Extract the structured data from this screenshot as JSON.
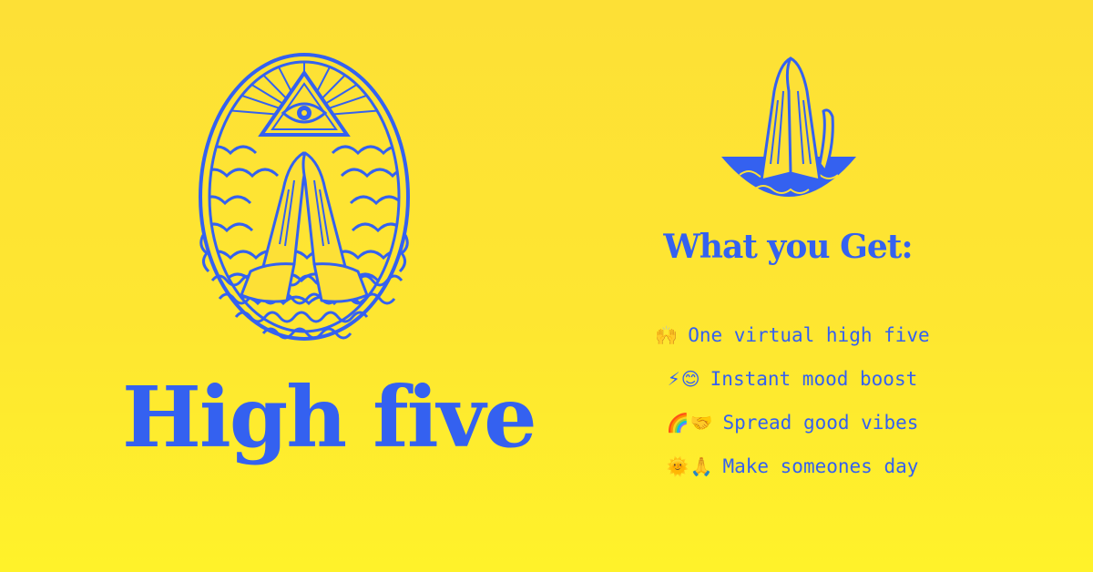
{
  "hero": {
    "title": "High five"
  },
  "sidebar": {
    "heading": "What you Get:",
    "items": [
      {
        "emoji": "🙌",
        "label": "One virtual high five"
      },
      {
        "emoji": "⚡😊",
        "label": "Instant mood boost"
      },
      {
        "emoji": "🌈🤝",
        "label": "Spread good vibes"
      },
      {
        "emoji": "🌞🙏",
        "label": "Make someones day"
      }
    ]
  },
  "colors": {
    "background_top": "#fde036",
    "background_bottom": "#fff22a",
    "ink": "#3461f0"
  },
  "icons": {
    "emblem": "praying-hands-eye-emblem-icon",
    "small": "praying-hands-icon"
  }
}
